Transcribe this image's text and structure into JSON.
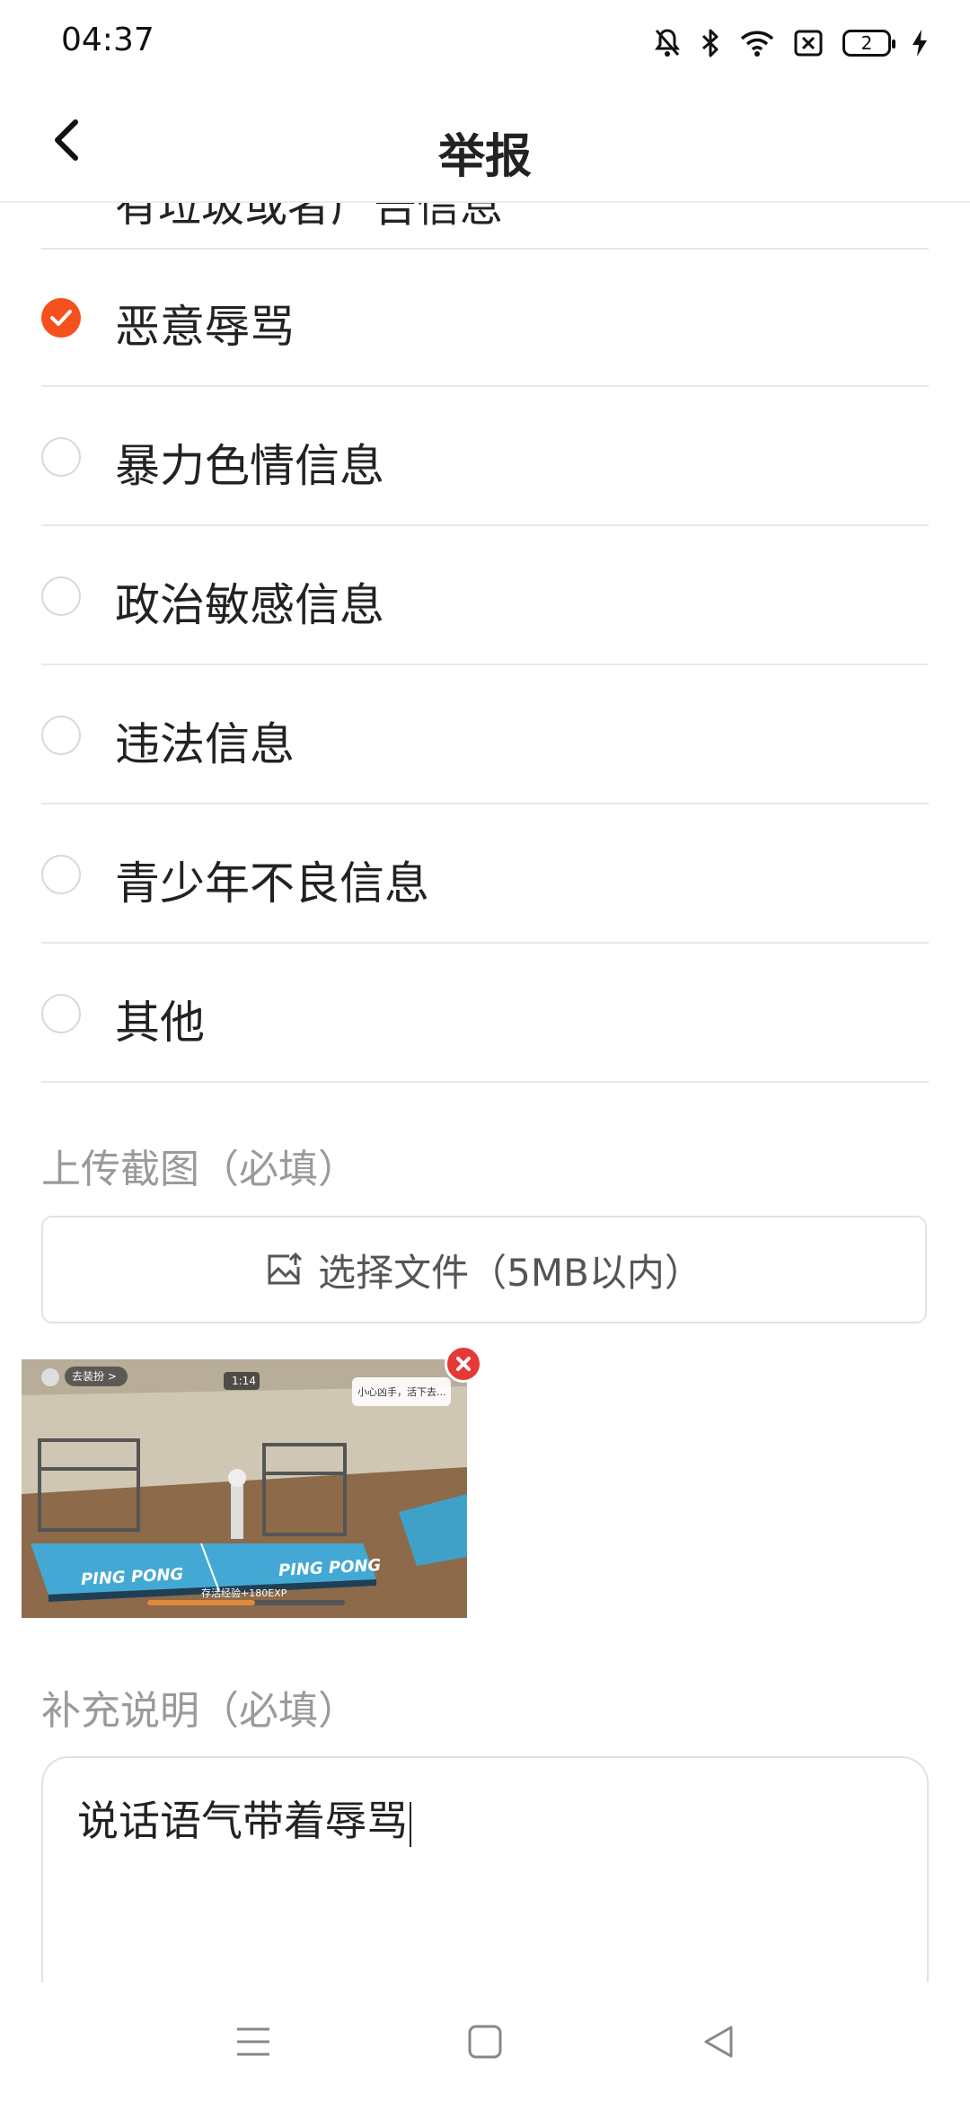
{
  "status": {
    "time": "04:37",
    "battery": "2"
  },
  "header": {
    "title": "举报"
  },
  "options": {
    "partial_label": "有垃圾或者广告信息",
    "items": [
      {
        "label": "恶意辱骂",
        "checked": true
      },
      {
        "label": "暴力色情信息",
        "checked": false
      },
      {
        "label": "政治敏感信息",
        "checked": false
      },
      {
        "label": "违法信息",
        "checked": false
      },
      {
        "label": "青少年不良信息",
        "checked": false
      },
      {
        "label": "其他",
        "checked": false
      }
    ]
  },
  "upload": {
    "section_label": "上传截图（必填）",
    "button_label": "选择文件（5MB以内）"
  },
  "thumbnail": {
    "chip": "去装扮 >",
    "timer": "1:14",
    "tip": "小心凶手，活下去...",
    "brand_left": "PING PONG",
    "brand_right": "PING PONG",
    "exp": "存活经验+180EXP"
  },
  "description": {
    "section_label": "补充说明（必填）",
    "value": "说话语气带着辱骂"
  },
  "colors": {
    "accent": "#f4511e",
    "close": "#e53935"
  }
}
